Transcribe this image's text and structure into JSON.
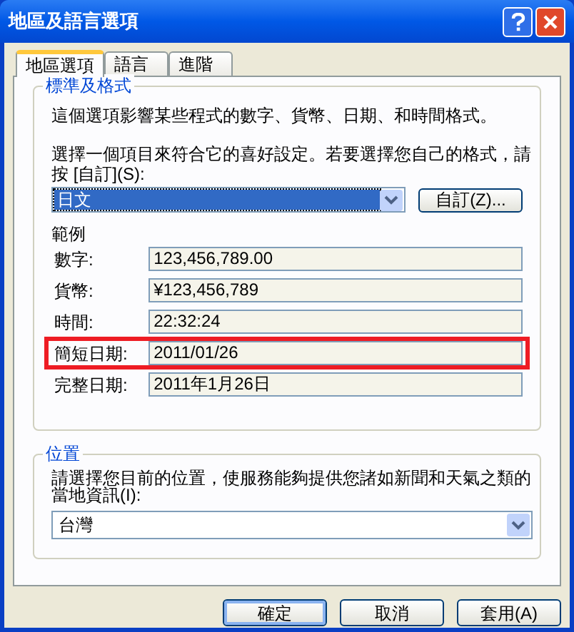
{
  "window": {
    "title": "地區及語言選項"
  },
  "tabs": [
    {
      "label": "地區選項",
      "selected": true
    },
    {
      "label": "語言",
      "selected": false
    },
    {
      "label": "進階",
      "selected": false
    }
  ],
  "standards": {
    "title": "標準及格式",
    "description": "這個選項影響某些程式的數字、貨幣、日期、和時間格式。",
    "instruction": "選擇一個項目來符合它的喜好設定。若要選擇您自己的格式，請按 [自訂](S):",
    "format": {
      "value": "日文",
      "focused": true
    },
    "customize_button": "自訂(Z)...",
    "samples_title": "範例",
    "samples": [
      {
        "label": "數字:",
        "value": "123,456,789.00",
        "highlighted": false
      },
      {
        "label": "貨幣:",
        "value": "¥123,456,789",
        "highlighted": false
      },
      {
        "label": "時間:",
        "value": "22:32:24",
        "highlighted": false
      },
      {
        "label": "簡短日期:",
        "value": "2011/01/26",
        "highlighted": true
      },
      {
        "label": "完整日期:",
        "value": "2011年1月26日",
        "highlighted": false
      }
    ]
  },
  "location": {
    "title": "位置",
    "description": "請選擇您目前的位置，使服務能夠提供您諸如新聞和天氣之類的當地資訊(I):",
    "value": "台灣"
  },
  "buttons": [
    {
      "label": "確定",
      "default": true
    },
    {
      "label": "取消",
      "default": false
    },
    {
      "label": "套用(A)",
      "default": false
    }
  ]
}
